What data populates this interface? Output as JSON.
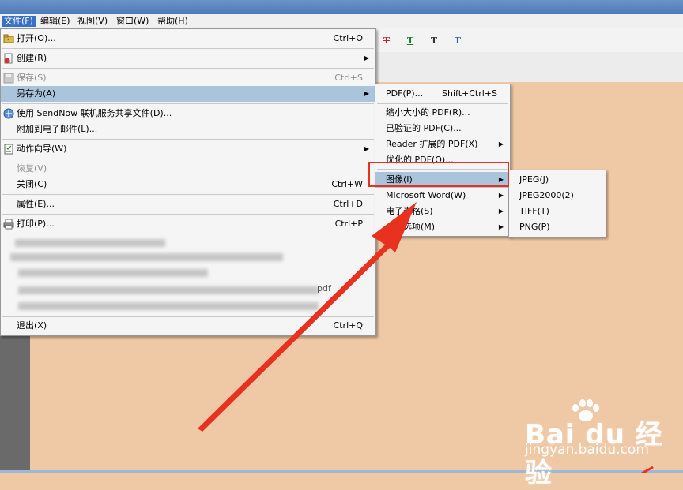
{
  "menubar": {
    "file": "文件(F)",
    "edit": "编辑(E)",
    "view": "视图(V)",
    "window": "窗口(W)",
    "help": "帮助(H)"
  },
  "file_menu": {
    "open": {
      "label": "打开(O)...",
      "shortcut": "Ctrl+O"
    },
    "create": {
      "label": "创建(R)"
    },
    "save": {
      "label": "保存(S)",
      "shortcut": "Ctrl+S"
    },
    "save_as": {
      "label": "另存为(A)"
    },
    "sendnow": {
      "label": "使用 SendNow 联机服务共享文件(D)..."
    },
    "attach_email": {
      "label": "附加到电子邮件(L)..."
    },
    "action_wizard": {
      "label": "动作向导(W)"
    },
    "revert": {
      "label": "恢复(V)"
    },
    "close": {
      "label": "关闭(C)",
      "shortcut": "Ctrl+W"
    },
    "properties": {
      "label": "属性(E)...",
      "shortcut": "Ctrl+D"
    },
    "print": {
      "label": "打印(P)...",
      "shortcut": "Ctrl+P"
    },
    "recent_fragment": "pdf",
    "exit": {
      "label": "退出(X)",
      "shortcut": "Ctrl+Q"
    }
  },
  "saveas_menu": {
    "pdf": {
      "label": "PDF(P)...",
      "shortcut": "Shift+Ctrl+S"
    },
    "reduced": {
      "label": "缩小大小的 PDF(R)..."
    },
    "certified": {
      "label": "已验证的 PDF(C)..."
    },
    "reader_ext": {
      "label": "Reader 扩展的 PDF(X)"
    },
    "optimized": {
      "label": "优化的 PDF(O)..."
    },
    "image": {
      "label": "图像(I)"
    },
    "word": {
      "label": "Microsoft Word(W)"
    },
    "spreadsheet": {
      "label": "电子表格(S)"
    },
    "more": {
      "label": "更多选项(M)"
    }
  },
  "image_menu": {
    "jpeg": "JPEG(J)",
    "jpeg2000": "JPEG2000(2)",
    "tiff": "TIFF(T)",
    "png": "PNG(P)"
  },
  "watermark": {
    "brand": "Bai du 经验",
    "url": "jingyan.baidu.com"
  },
  "colors": {
    "doc_background": "#efc9a6",
    "menu_highlight": "#aac4dc",
    "annotation_red": "#e8311f"
  }
}
